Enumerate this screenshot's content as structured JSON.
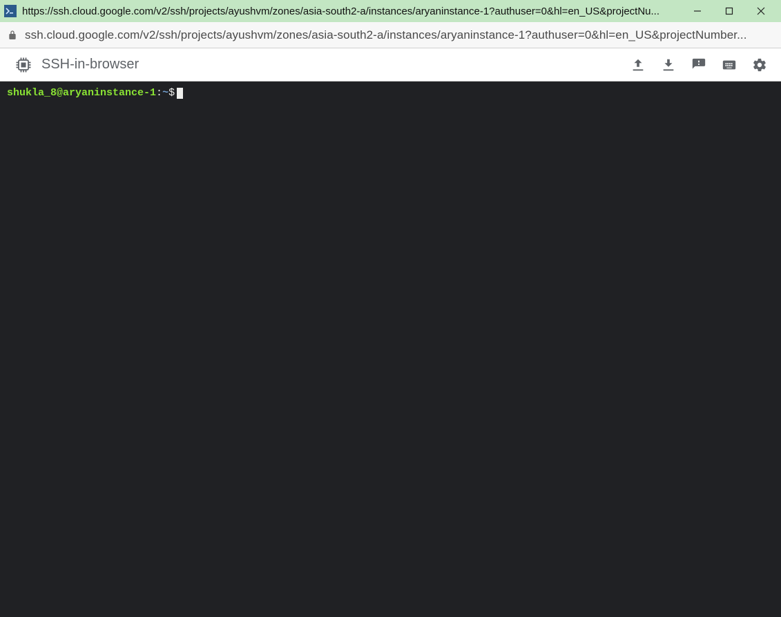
{
  "window": {
    "title_url": "https://ssh.cloud.google.com/v2/ssh/projects/ayushvm/zones/asia-south2-a/instances/aryaninstance-1?authuser=0&hl=en_US&projectNu..."
  },
  "address_bar": {
    "url": "ssh.cloud.google.com/v2/ssh/projects/ayushvm/zones/asia-south2-a/instances/aryaninstance-1?authuser=0&hl=en_US&projectNumber..."
  },
  "header": {
    "title": "SSH-in-browser"
  },
  "terminal": {
    "user_host": "shukla_8@aryaninstance-1",
    "separator": ":",
    "path": "~",
    "prompt_symbol": "$"
  },
  "colors": {
    "titlebar_bg": "#c3e6c3",
    "terminal_bg": "#202124",
    "prompt_user": "#8ae234",
    "prompt_path": "#729fcf"
  }
}
